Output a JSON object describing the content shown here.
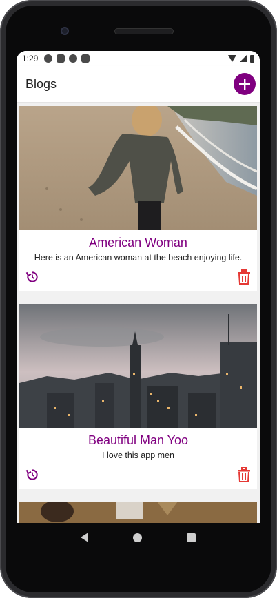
{
  "status_bar": {
    "time": "1:29",
    "icons": [
      "accessibility-icon",
      "a-icon",
      "play-icon",
      "sd-card-icon"
    ],
    "right_icons": [
      "wifi-icon",
      "signal-icon",
      "battery-icon"
    ]
  },
  "app_bar": {
    "title": "Blogs",
    "add_icon": "plus-icon",
    "accent": "#800080"
  },
  "blogs": [
    {
      "title": "American Woman",
      "body": "Here is an American woman at the beach enjoying life.",
      "image": "woman-on-beach-photo",
      "edit_icon": "history-icon",
      "delete_icon": "trash-icon"
    },
    {
      "title": "Beautiful Man Yoo",
      "body": "I love this app men",
      "image": "city-skyline-photo",
      "edit_icon": "history-icon",
      "delete_icon": "trash-icon"
    },
    {
      "image": "child-in-grass-photo"
    }
  ],
  "colors": {
    "title": "#800080",
    "delete": "#e53935",
    "edit": "#800080"
  },
  "nav_bar": {
    "buttons": [
      "back-icon",
      "home-icon",
      "recents-icon"
    ]
  }
}
